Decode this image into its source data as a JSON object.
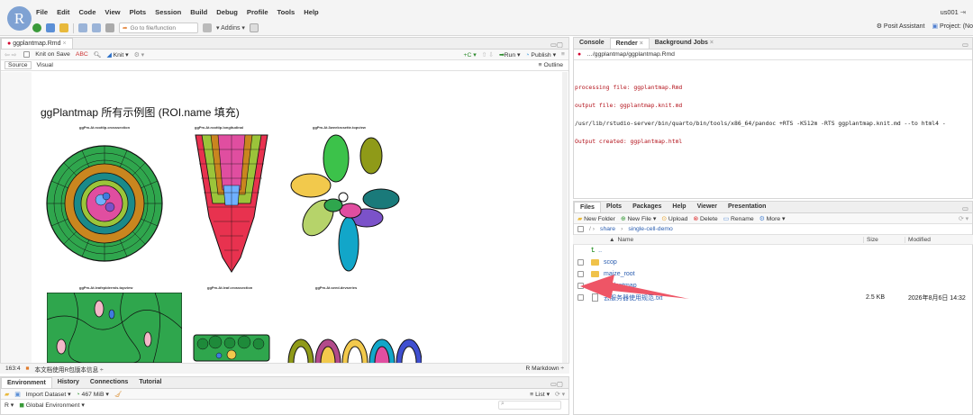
{
  "topbar": {
    "logo": "R",
    "menus": [
      "File",
      "Edit",
      "Code",
      "View",
      "Plots",
      "Session",
      "Build",
      "Debug",
      "Profile",
      "Tools",
      "Help"
    ],
    "goto_placeholder": "Go to file/function",
    "addins_label": "Addins",
    "user": "us001",
    "assistant": "Posit Assistant",
    "project": "Project: (No"
  },
  "editor": {
    "tab": "ggplantmap.Rmd",
    "knit_on_save": "Knit on Save",
    "knit": "Knit",
    "run": "Run",
    "publish": "Publish",
    "mode_source": "Source",
    "mode_visual": "Visual",
    "outline": "Outline",
    "doc_title": "ggPlantmap 所有示例图 (ROI.name 填充)",
    "figures": [
      "ggPm.At.roottip.crosssection",
      "ggPm.At.roottip.longitudinal",
      "ggPm.At.3weekrosette.topview",
      "ggPm.At.leafepidermis.topview",
      "ggPm.At.leaf.crosssection",
      "ggPm.At.seed.devseries"
    ],
    "cursor_pos": "163:4",
    "chunk_label": "本文档使用R包版本信息",
    "doc_type": "R Markdown"
  },
  "env": {
    "tabs": [
      "Environment",
      "History",
      "Connections",
      "Tutorial"
    ],
    "import": "Import Dataset",
    "memory": "467 MiB",
    "view": "List",
    "r_label": "R",
    "scope": "Global Environment"
  },
  "console": {
    "tabs": [
      "Console",
      "Render",
      "Background Jobs"
    ],
    "path": "…/ggplantmap/ggplantmap.Rmd",
    "lines": [
      "processing file: ggplantmap.Rmd",
      "output file: ggplantmap.knit.md",
      "/usr/lib/rstudio-server/bin/quarto/bin/tools/x86_64/pandoc +RTS -K512m -RTS ggplantmap.knit.md --to html4 -",
      "Output created: ggplantmap.html"
    ]
  },
  "files": {
    "tabs": [
      "Files",
      "Plots",
      "Packages",
      "Help",
      "Viewer",
      "Presentation"
    ],
    "toolbar": [
      "New Folder",
      "New File",
      "Upload",
      "Delete",
      "Rename",
      "More"
    ],
    "breadcrumb": [
      "share",
      "single-cell-demo"
    ],
    "columns": [
      "Name",
      "Size",
      "Modified"
    ],
    "parent": "..",
    "rows": [
      {
        "name": "scop",
        "size": "",
        "modified": ""
      },
      {
        "name": "maize_root",
        "size": "",
        "modified": ""
      },
      {
        "name": "ggplantmap",
        "size": "",
        "modified": ""
      },
      {
        "name": "云服务器使用规范.txt",
        "size": "2.5 KB",
        "modified": "2026年8月6日 14:32"
      }
    ]
  },
  "colors": {
    "accent_red": "#d3002d",
    "console_red": "#b3121b",
    "link_blue": "#2a5db0",
    "arrow": "#ee5566"
  }
}
